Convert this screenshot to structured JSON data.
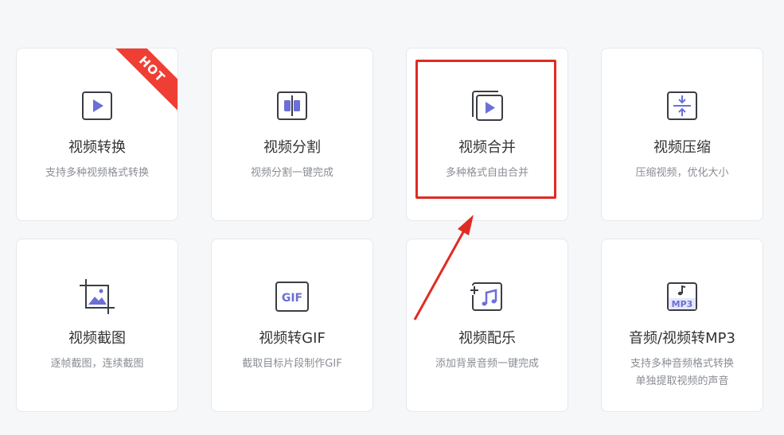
{
  "cards": [
    {
      "title": "视频转换",
      "desc": "支持多种视频格式转换",
      "icon": "video-play-icon",
      "badge": "HOT"
    },
    {
      "title": "视频分割",
      "desc": "视频分割一键完成",
      "icon": "split-icon"
    },
    {
      "title": "视频合并",
      "desc": "多种格式自由合并",
      "icon": "merge-icon"
    },
    {
      "title": "视频压缩",
      "desc": "压缩视频，优化大小",
      "icon": "compress-icon"
    },
    {
      "title": "视频截图",
      "desc": "逐帧截图，连续截图",
      "icon": "crop-image-icon"
    },
    {
      "title": "视频转GIF",
      "desc": "截取目标片段制作GIF",
      "icon": "gif-icon",
      "icon_text": "GIF"
    },
    {
      "title": "视频配乐",
      "desc": "添加背景音频一键完成",
      "icon": "add-music-icon"
    },
    {
      "title": "音频/视频转MP3",
      "desc": "支持多种音频格式转换",
      "desc2": "单独提取视频的声音",
      "icon": "mp3-icon",
      "icon_text": "MP3"
    }
  ],
  "colors": {
    "accent": "#6b6fd6",
    "icon_stroke": "#3a3d44",
    "hot_badge": "#ef3f34",
    "annotation": "#e02b23"
  }
}
